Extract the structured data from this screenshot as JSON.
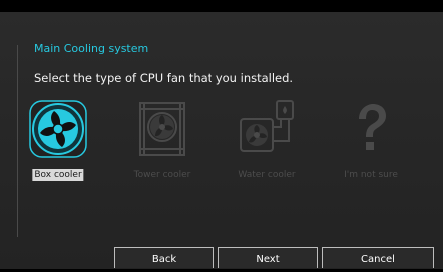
{
  "header": {
    "title": "Main Cooling system",
    "prompt": "Select the type of CPU fan that you installed."
  },
  "options": [
    {
      "label": "Box cooler",
      "icon": "box-cooler-fan-icon",
      "selected": true
    },
    {
      "label": "Tower cooler",
      "icon": "tower-cooler-icon",
      "selected": false
    },
    {
      "label": "Water cooler",
      "icon": "water-cooler-icon",
      "selected": false
    },
    {
      "label": "I'm not sure",
      "icon": "question-mark-icon",
      "selected": false
    }
  ],
  "buttons": {
    "back": "Back",
    "next": "Next",
    "cancel": "Cancel"
  },
  "colors": {
    "accent": "#27c9e0",
    "inactive": "#4a4a4a"
  }
}
